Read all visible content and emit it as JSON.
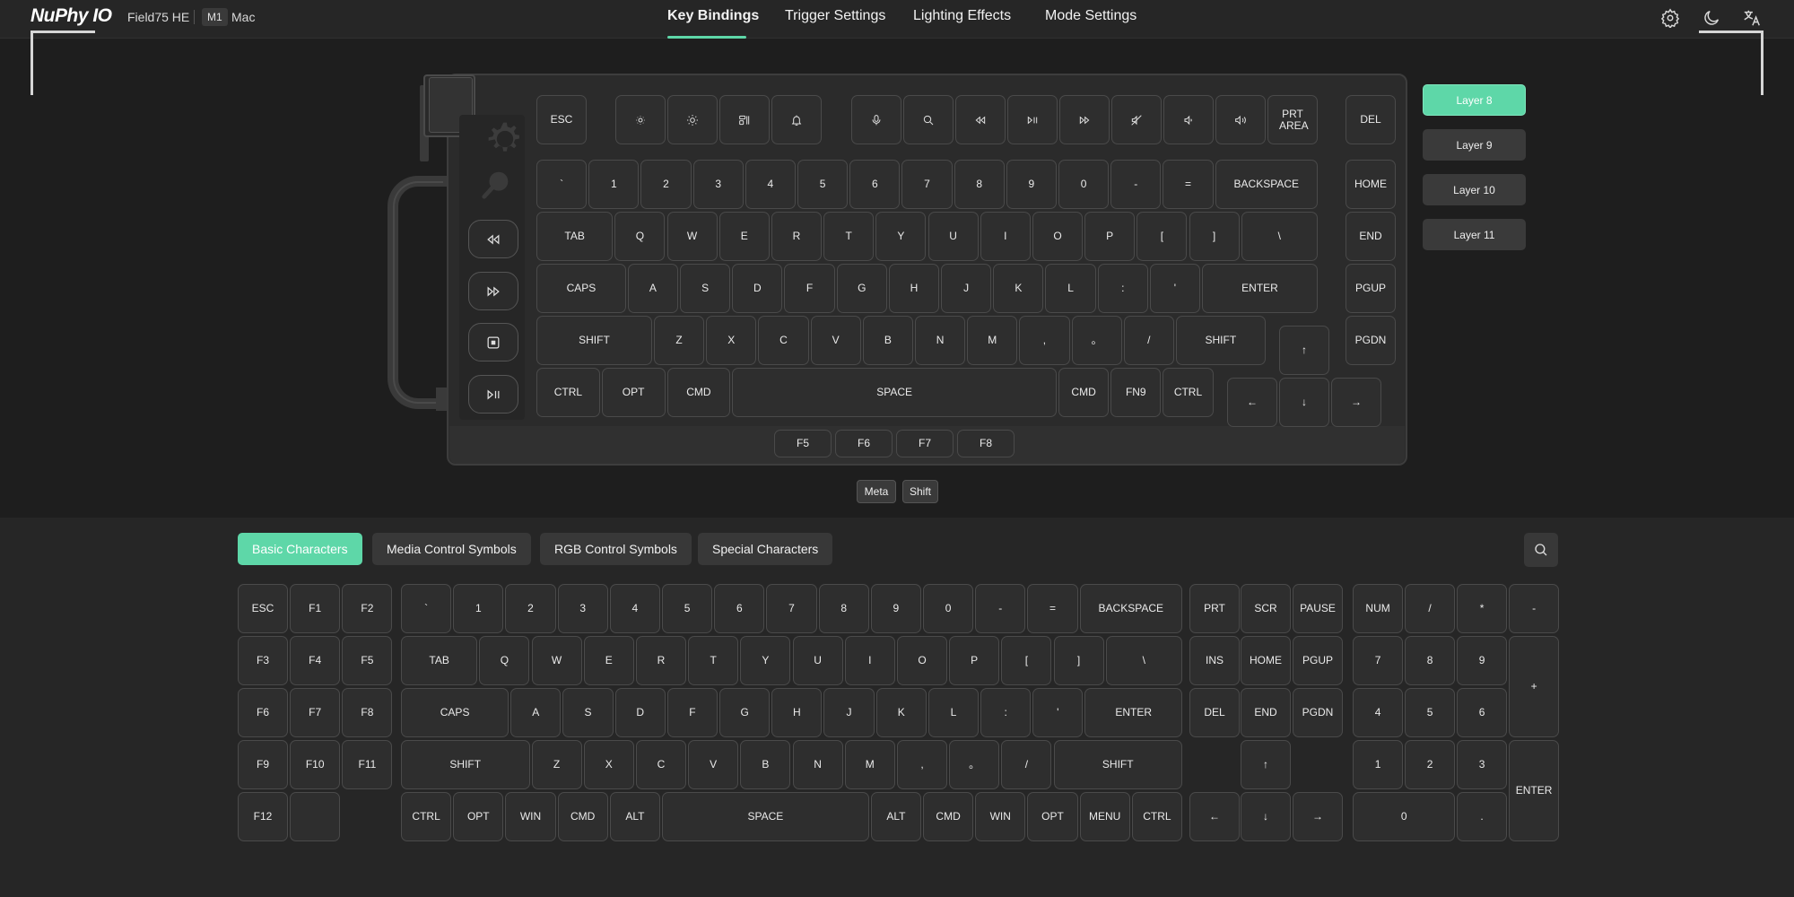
{
  "header": {
    "logo": "NuPhy IO",
    "device": "Field75 HE",
    "chip": "M1",
    "os": "Mac",
    "nav": [
      "Key Bindings",
      "Trigger Settings",
      "Lighting Effects",
      "Mode Settings"
    ],
    "active_nav": "Key Bindings",
    "icons": [
      "gear-icon",
      "moon-icon",
      "translate-icon"
    ]
  },
  "colors": {
    "accent": "#5ed7a8",
    "background": "#1e1e1e",
    "panel": "#262626",
    "key": "#2e2e2e"
  },
  "keyboard": {
    "rows": [
      {
        "keys": [
          "ESC",
          "brightness-down-icon",
          "brightness-up-icon",
          "task-view-icon",
          "bell-icon",
          "mic-icon",
          "search-icon",
          "rewind-icon",
          "play-pause-icon",
          "fast-forward-icon",
          "mute-icon",
          "volume-down-icon",
          "volume-up-icon",
          "PRT AREA",
          "DEL"
        ]
      },
      {
        "keys": [
          "`",
          "1",
          "2",
          "3",
          "4",
          "5",
          "6",
          "7",
          "8",
          "9",
          "0",
          "-",
          "=",
          "BACKSPACE",
          "HOME"
        ]
      },
      {
        "keys": [
          "TAB",
          "Q",
          "W",
          "E",
          "R",
          "T",
          "Y",
          "U",
          "I",
          "O",
          "P",
          "[",
          "]",
          "\\",
          "END"
        ]
      },
      {
        "keys": [
          "CAPS",
          "A",
          "S",
          "D",
          "F",
          "G",
          "H",
          "J",
          "K",
          "L",
          ":",
          "'",
          "ENTER",
          "PGUP"
        ]
      },
      {
        "keys": [
          "SHIFT",
          "Z",
          "X",
          "C",
          "V",
          "B",
          "N",
          "M",
          ",",
          "。",
          "/",
          "SHIFT",
          "↑",
          "PGDN"
        ]
      },
      {
        "keys": [
          "CTRL",
          "OPT",
          "CMD",
          "SPACE",
          "CMD",
          "FN9",
          "CTRL",
          "←",
          "↓",
          "→"
        ]
      }
    ],
    "fkeys": [
      "F5",
      "F6",
      "F7",
      "F8"
    ],
    "side_keys": [
      "rewind-icon",
      "fast-forward-icon",
      "screenshot-icon",
      "play-pause-icon"
    ]
  },
  "layers": [
    "Layer 8",
    "Layer 9",
    "Layer 10",
    "Layer 11"
  ],
  "active_layer": "Layer 8",
  "modifiers": [
    "Meta",
    "Shift"
  ],
  "tabs": [
    "Basic Characters",
    "Media Control Symbols",
    "RGB Control Symbols",
    "Special Characters"
  ],
  "active_tab": "Basic Characters",
  "palette": {
    "fcol": [
      "ESC",
      "F1",
      "F2",
      "F3",
      "F4",
      "F5",
      "F6",
      "F7",
      "F8",
      "F9",
      "F10",
      "F11",
      "F12",
      ""
    ],
    "main": [
      [
        "`",
        "1",
        "2",
        "3",
        "4",
        "5",
        "6",
        "7",
        "8",
        "9",
        "0",
        "-",
        "=",
        "BACKSPACE"
      ],
      [
        "TAB",
        "Q",
        "W",
        "E",
        "R",
        "T",
        "Y",
        "U",
        "I",
        "O",
        "P",
        "[",
        "]",
        "\\"
      ],
      [
        "CAPS",
        "A",
        "S",
        "D",
        "F",
        "G",
        "H",
        "J",
        "K",
        "L",
        ":",
        "'",
        "ENTER"
      ],
      [
        "SHIFT",
        "Z",
        "X",
        "C",
        "V",
        "B",
        "N",
        "M",
        ",",
        "。",
        "/",
        "SHIFT"
      ],
      [
        "CTRL",
        "OPT",
        "WIN",
        "CMD",
        "ALT",
        "SPACE",
        "ALT",
        "CMD",
        "WIN",
        "OPT",
        "MENU",
        "CTRL"
      ]
    ],
    "nav": [
      [
        "PRT",
        "SCR",
        "PAUSE"
      ],
      [
        "INS",
        "HOME",
        "PGUP"
      ],
      [
        "DEL",
        "END",
        "PGDN"
      ],
      [
        "↑"
      ],
      [
        "←",
        "↓",
        "→"
      ]
    ],
    "numpad": [
      "NUM",
      "/",
      "*",
      "-",
      "7",
      "8",
      "9",
      "+",
      "4",
      "5",
      "6",
      "1",
      "2",
      "3",
      "ENTER",
      "0",
      "."
    ]
  }
}
